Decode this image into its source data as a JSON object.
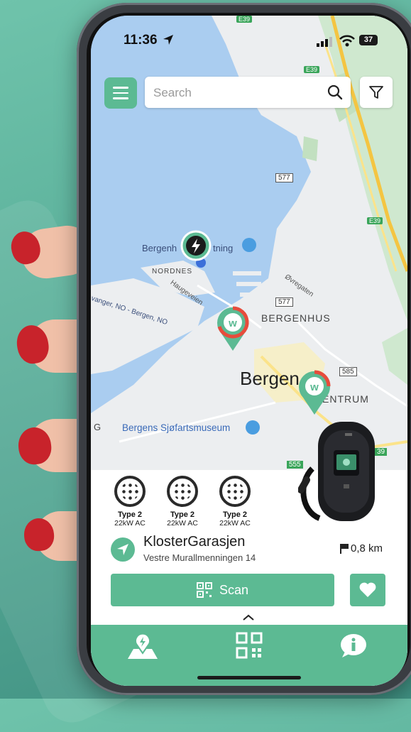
{
  "status_bar": {
    "time": "11:36",
    "battery": "37"
  },
  "search": {
    "placeholder": "Search"
  },
  "map": {
    "labels": {
      "e39_top": "E39",
      "e39_mid": "E39",
      "e39_right": "E39",
      "r577_top": "577",
      "r577_mid": "577",
      "r585": "585",
      "r555": "555",
      "r539": "39",
      "bergenh_left": "Bergenh",
      "bergenh_right": "tning",
      "nordnes": "NORDNES",
      "haugeveien": "Haugeveien",
      "ovregaten": "Øvregaten",
      "bergenhus": "BERGENHUS",
      "bergen": "Bergen",
      "sentrum": "ENTRUM",
      "museum": "Bergens Sjøfartsmuseum",
      "vanger": "vanger, NO - Bergen, NO",
      "g_edge": "G"
    }
  },
  "station": {
    "connectors": [
      {
        "type": "Type 2",
        "power": "22kW AC"
      },
      {
        "type": "Type 2",
        "power": "22kW AC"
      },
      {
        "type": "Type 2",
        "power": "22kW AC"
      }
    ],
    "name": "KlosterGarasjen",
    "address": "Vestre Murallmenningen 14",
    "distance": "0,8 km"
  },
  "actions": {
    "scan_label": "Scan"
  },
  "icons": {
    "menu": "hamburger-icon",
    "search": "search-icon",
    "filter": "filter-icon",
    "navigate": "navigation-arrow-icon",
    "distance": "flag-icon",
    "scan": "qr-code-icon",
    "favorite": "heart-icon",
    "expand": "chevron-up-icon",
    "nav_map": "map-pin-icon",
    "nav_qr": "qr-code-icon",
    "nav_info": "info-icon"
  },
  "colors": {
    "accent": "#5cba93",
    "map_water": "#aacdf0",
    "pin_red": "#e74c3c"
  }
}
